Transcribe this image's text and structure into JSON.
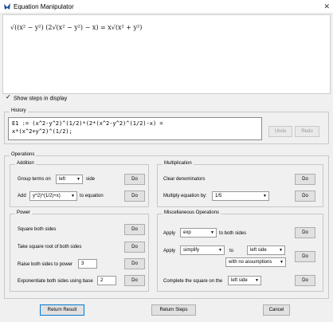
{
  "window": {
    "title": "Equation Manipulator",
    "close_glyph": "✕"
  },
  "display": {
    "equation_parts": [
      "√((x² − y²)",
      "(2√(x² − y²) − x)",
      "= x√(x² + y²)"
    ]
  },
  "checkbox": {
    "label": "Show steps in display"
  },
  "history": {
    "label": "History",
    "code_lines": [
      "E1 := (x^2-y^2)^(1/2)*(2*(x^2-y^2)^(1/2)-x) =",
      "x*(x^2+y^2)^(1/2);"
    ],
    "undo": "Undo",
    "redo": "Redo"
  },
  "operations": {
    "label": "Operations",
    "addition": {
      "label": "Addition",
      "group_terms_label": "Group terms on",
      "side_value": "left",
      "side_suffix": "side",
      "add_label": "Add",
      "add_value": "y^2)^(1/2)+x)",
      "add_suffix": "to equation",
      "do": "Do"
    },
    "multiplication": {
      "label": "Multiplication",
      "clear_denominators": "Clear denominators",
      "multiply_label": "Multiply equation by:",
      "multiply_value": "1/5",
      "do": "Do"
    },
    "power": {
      "label": "Power",
      "square": "Square both sides",
      "sqrt": "Take square root of both sides",
      "raise_label": "Raise both sides to power",
      "raise_value": "3",
      "exp_label": "Exponentiate both sides using base",
      "exp_value": "2",
      "do": "Do"
    },
    "misc": {
      "label": "Miscellaneous Operations",
      "apply1_label": "Apply",
      "apply1_value": "exp",
      "apply1_suffix": "to both sides",
      "apply2_label": "Apply",
      "apply2_value": "simplify",
      "to_label": "to",
      "side_value": "left side",
      "assumptions_value": "with no assumptions",
      "complete_label": "Complete the square on the",
      "complete_value": "left side",
      "do": "Do"
    }
  },
  "footer": {
    "return_result": "Return Result",
    "return_steps": "Return Steps",
    "cancel": "Cancel"
  },
  "colors": {
    "accent": "#0078d7",
    "app_icon": "#1a4f9c"
  }
}
